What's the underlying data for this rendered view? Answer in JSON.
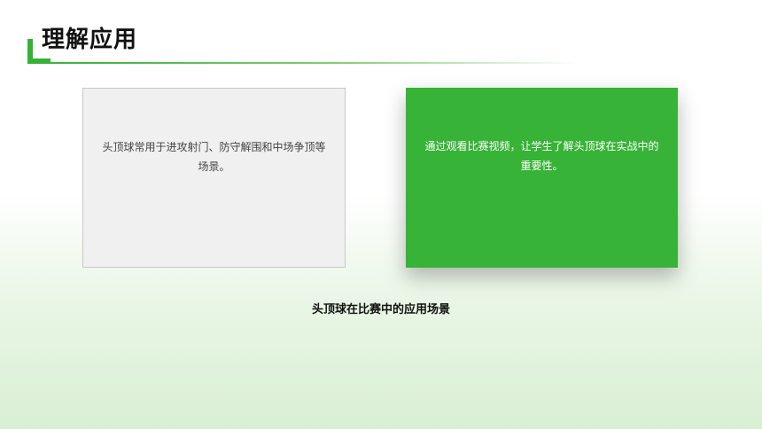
{
  "title": "理解应用",
  "cards": [
    {
      "text": "头顶球常用于进攻射门、防守解围和中场争顶等场景。"
    },
    {
      "text": "通过观看比赛视频，让学生了解头顶球在实战中的重要性。"
    }
  ],
  "caption": "头顶球在比赛中的应用场景",
  "colors": {
    "accent": "#36b236",
    "card_left_bg": "#f1f0f0",
    "card_right_bg": "#37b337"
  }
}
